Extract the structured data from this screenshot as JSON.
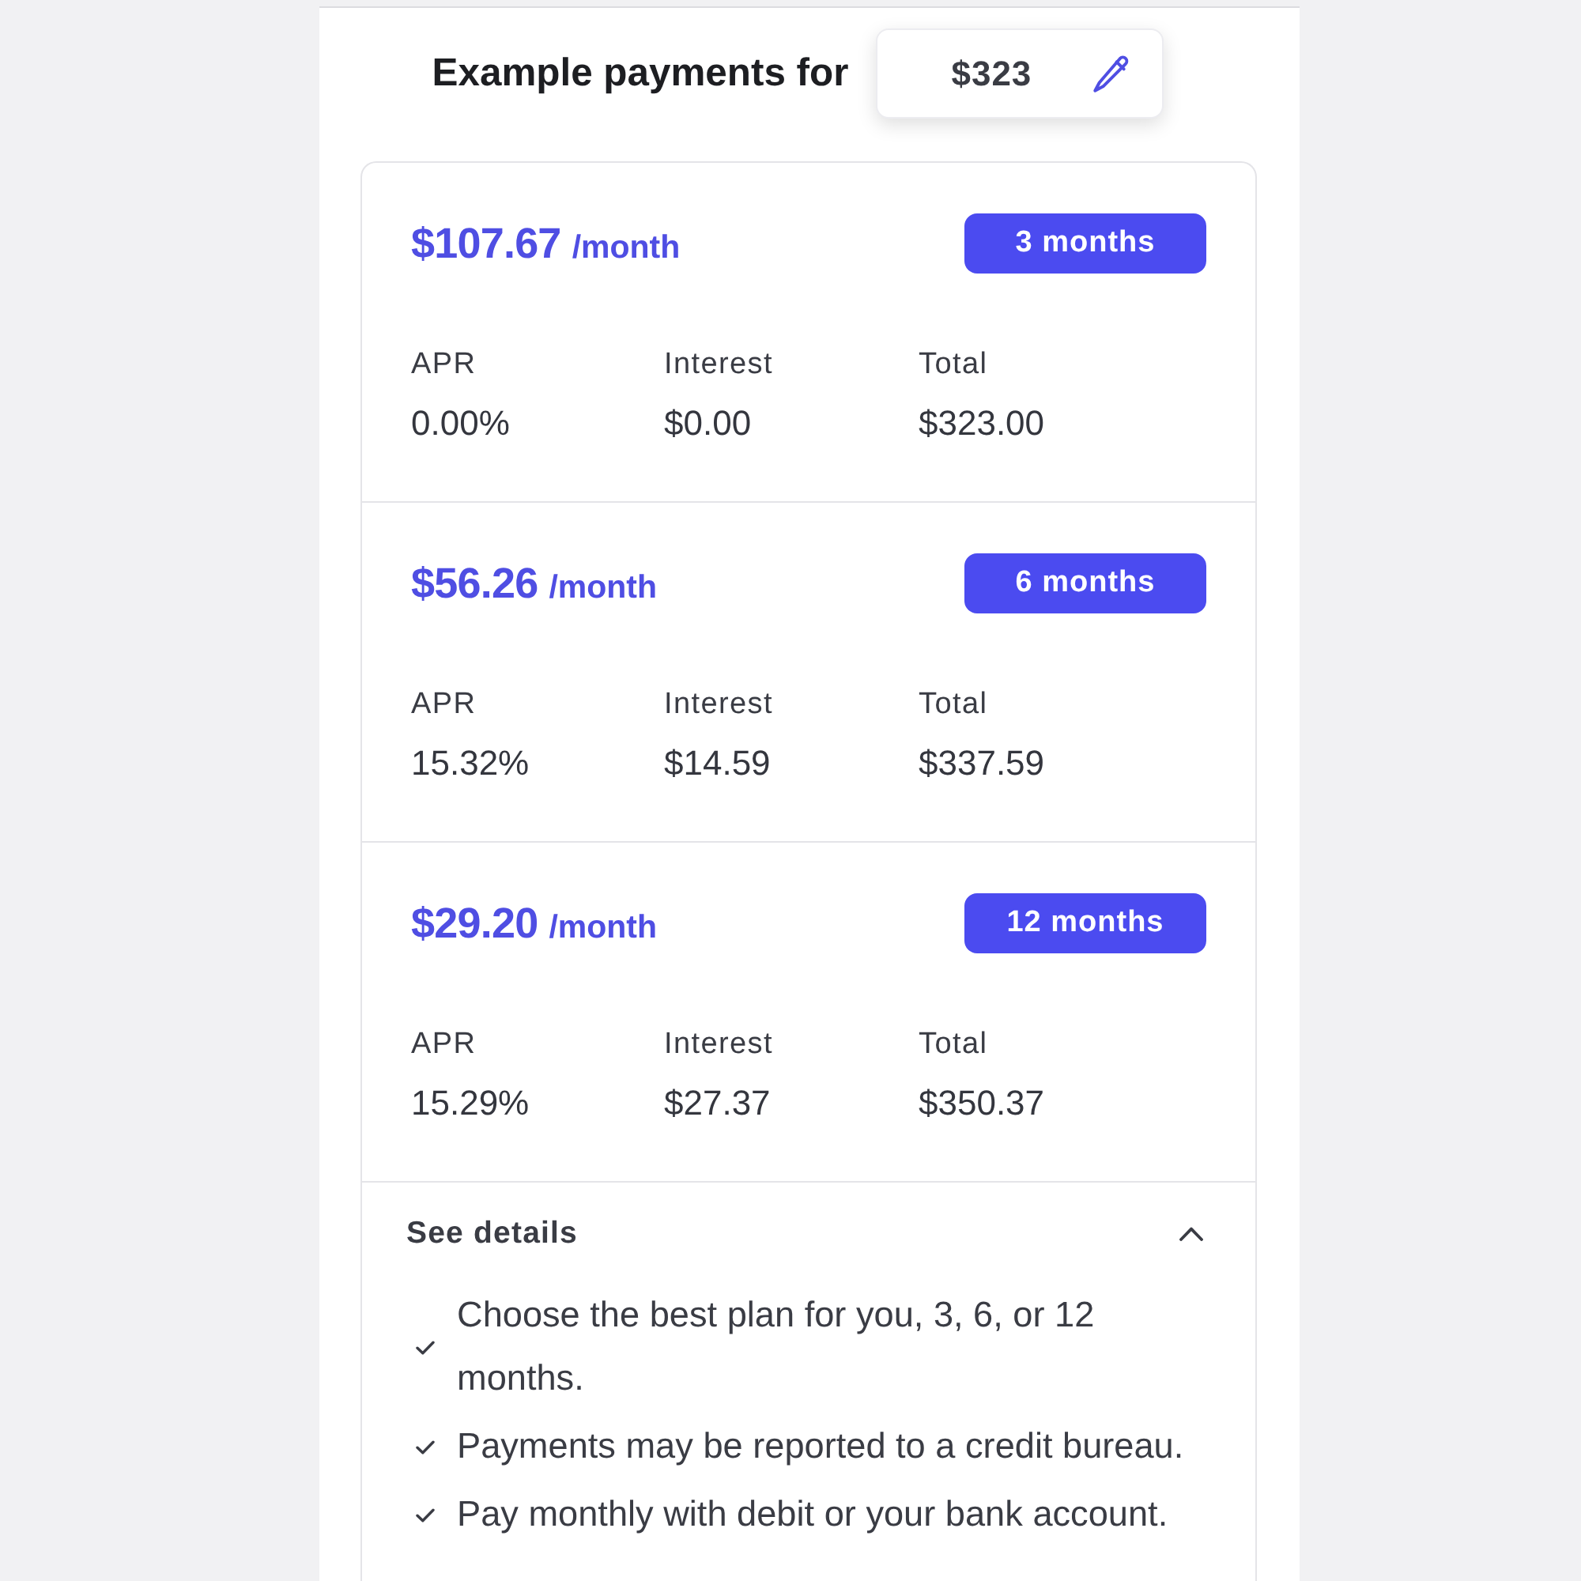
{
  "header": {
    "title": "Example payments for",
    "amount": "$323"
  },
  "plans": [
    {
      "price": "$107.67",
      "period": "/month",
      "term": "3 months",
      "stats": [
        {
          "label": "APR",
          "value": "0.00%"
        },
        {
          "label": "Interest",
          "value": "$0.00"
        },
        {
          "label": "Total",
          "value": "$323.00"
        }
      ]
    },
    {
      "price": "$56.26",
      "period": "/month",
      "term": "6 months",
      "stats": [
        {
          "label": "APR",
          "value": "15.32%"
        },
        {
          "label": "Interest",
          "value": "$14.59"
        },
        {
          "label": "Total",
          "value": "$337.59"
        }
      ]
    },
    {
      "price": "$29.20",
      "period": "/month",
      "term": "12 months",
      "stats": [
        {
          "label": "APR",
          "value": "15.29%"
        },
        {
          "label": "Interest",
          "value": "$27.37"
        },
        {
          "label": "Total",
          "value": "$350.37"
        }
      ]
    }
  ],
  "details": {
    "title": "See details",
    "expanded": true,
    "items": [
      "Choose the best plan for you, 3, 6, or 12 months.",
      "Payments may be reported to a credit bureau.",
      "Pay monthly with debit or your bank account."
    ]
  }
}
